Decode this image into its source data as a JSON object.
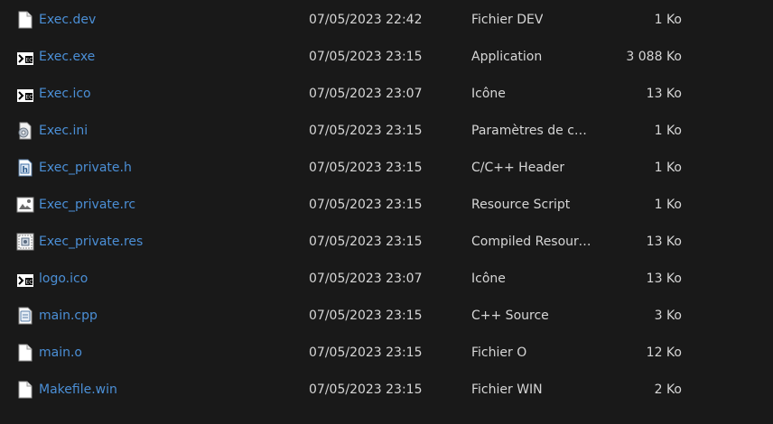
{
  "files": [
    {
      "name": "Exec.dev",
      "date": "07/05/2023 22:42",
      "type": "Fichier DEV",
      "size": "1 Ko",
      "icon": "document-icon"
    },
    {
      "name": "Exec.exe",
      "date": "07/05/2023 23:15",
      "type": "Application",
      "size": "3 088 Ko",
      "icon": "exe-app-icon"
    },
    {
      "name": "Exec.ico",
      "date": "07/05/2023 23:07",
      "type": "Icône",
      "size": "13 Ko",
      "icon": "ico-image-icon"
    },
    {
      "name": "Exec.ini",
      "date": "07/05/2023 23:15",
      "type": "Paramètres de con...",
      "size": "1 Ko",
      "icon": "settings-file-icon"
    },
    {
      "name": "Exec_private.h",
      "date": "07/05/2023 23:15",
      "type": "C/C++ Header",
      "size": "1 Ko",
      "icon": "header-file-icon"
    },
    {
      "name": "Exec_private.rc",
      "date": "07/05/2023 23:15",
      "type": "Resource Script",
      "size": "1 Ko",
      "icon": "resource-script-icon"
    },
    {
      "name": "Exec_private.res",
      "date": "07/05/2023 23:15",
      "type": "Compiled Resourc...",
      "size": "13 Ko",
      "icon": "compiled-resource-icon"
    },
    {
      "name": "logo.ico",
      "date": "07/05/2023 23:07",
      "type": "Icône",
      "size": "13 Ko",
      "icon": "ico-image-icon"
    },
    {
      "name": "main.cpp",
      "date": "07/05/2023 23:15",
      "type": "C++ Source",
      "size": "3 Ko",
      "icon": "cpp-source-icon"
    },
    {
      "name": "main.o",
      "date": "07/05/2023 23:15",
      "type": "Fichier O",
      "size": "12 Ko",
      "icon": "document-icon"
    },
    {
      "name": "Makefile.win",
      "date": "07/05/2023 23:15",
      "type": "Fichier WIN",
      "size": "2 Ko",
      "icon": "document-icon"
    }
  ],
  "colors": {
    "background": "#191919",
    "name_link": "#4b8fd6",
    "text": "#d6d6d6"
  }
}
